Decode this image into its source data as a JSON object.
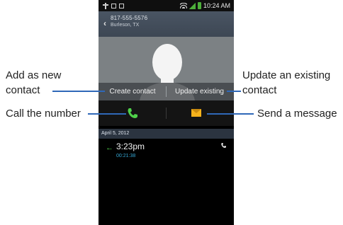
{
  "status_bar": {
    "time": "10:24 AM"
  },
  "contact": {
    "phone_number": "817-555-5576",
    "location": "Burleson, TX"
  },
  "actions": {
    "create_contact": "Create contact",
    "update_existing": "Update existing"
  },
  "call_log": {
    "date": "April 5, 2012",
    "time": "3:23pm",
    "duration": "00:21:38"
  },
  "callouts": {
    "add_new_line1": "Add as new",
    "add_new_line2": "contact",
    "update_line1": "Update an existing",
    "update_line2": "contact",
    "call": "Call the number",
    "message": "Send a message"
  },
  "colors": {
    "callout_line": "#2f68b8",
    "call_green": "#4fd14a",
    "message_yellow": "#f5b21c"
  }
}
